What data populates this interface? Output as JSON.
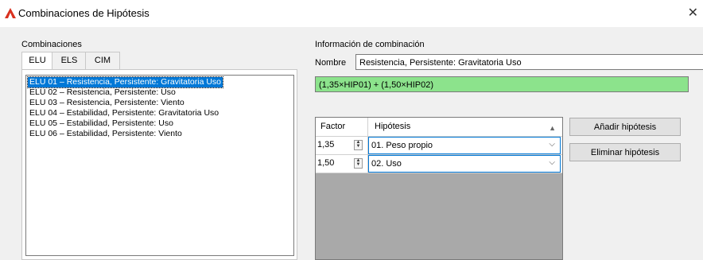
{
  "window": {
    "title": "Combinaciones de Hipótesis",
    "close_glyph": "✕"
  },
  "left": {
    "group_label": "Combinaciones",
    "tabs": [
      {
        "label": "ELU"
      },
      {
        "label": "ELS"
      },
      {
        "label": "CIM"
      }
    ],
    "selected_tab": "ELU",
    "items": [
      {
        "label": "ELU 01 – Resistencia, Persistente: Gravitatoria Uso"
      },
      {
        "label": "ELU 02 – Resistencia, Persistente: Uso"
      },
      {
        "label": "ELU 03 – Resistencia, Persistente: Viento"
      },
      {
        "label": "ELU 04 – Estabilidad, Persistente: Gravitatoria Uso"
      },
      {
        "label": "ELU 05 – Estabilidad, Persistente: Uso"
      },
      {
        "label": "ELU 06 – Estabilidad, Persistente: Viento"
      }
    ],
    "selected_item": "ELU 01 – Resistencia, Persistente: Gravitatoria Uso"
  },
  "right": {
    "group_label": "Información de combinación",
    "name_label": "Nombre",
    "name_value": "Resistencia, Persistente: Gravitatoria Uso",
    "formula": "(1,35×HIP01) + (1,50×HIP02)",
    "formula_color": "#8ce38c",
    "grid": {
      "headers": {
        "factor": "Factor",
        "hipotesis": "Hipótesis"
      },
      "rows": [
        {
          "factor": "1,35",
          "hipotesis": "01. Peso propio"
        },
        {
          "factor": "1,50",
          "hipotesis": "02. Uso"
        }
      ]
    },
    "buttons": {
      "add": "Añadir hipótesis",
      "remove": "Eliminar hipótesis"
    }
  },
  "colors": {
    "selection": "#0078d7",
    "app_icon": "#d9311f"
  },
  "icons": {
    "app": "app-logo-icon",
    "close": "close-icon",
    "spinner": "spinner-up-down-icon",
    "dropdown": "chevron-down-icon",
    "sort": "sort-up-icon"
  }
}
